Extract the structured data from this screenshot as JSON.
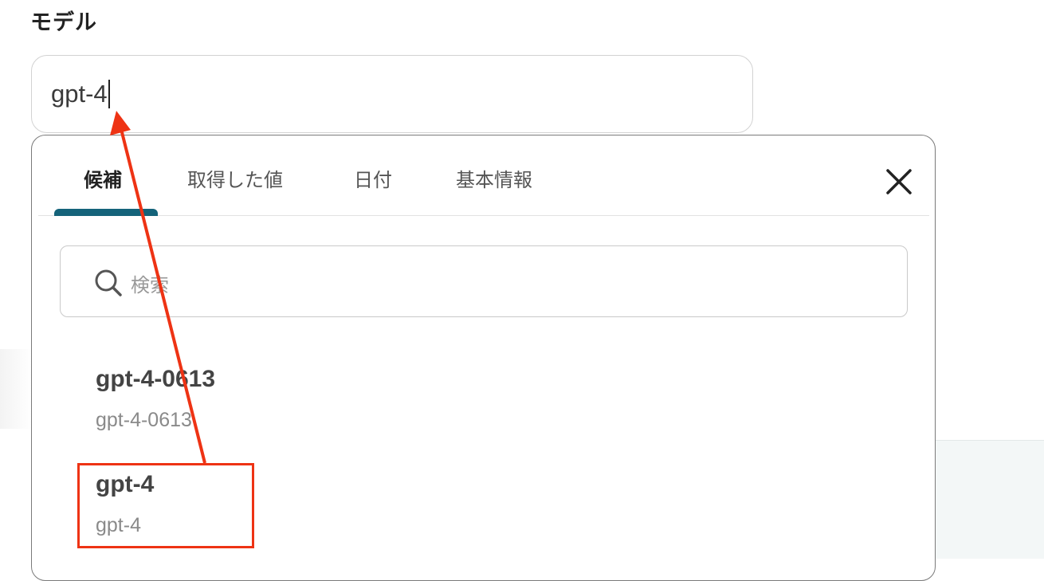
{
  "field": {
    "label": "モデル",
    "value": "gpt-4"
  },
  "tabs": [
    {
      "label": "候補",
      "active": true
    },
    {
      "label": "取得した値",
      "active": false
    },
    {
      "label": "日付",
      "active": false
    },
    {
      "label": "基本情報",
      "active": false
    }
  ],
  "search": {
    "placeholder": "検索"
  },
  "options": [
    {
      "title": "gpt-4-0613",
      "subtitle": "gpt-4-0613"
    },
    {
      "title": "gpt-4",
      "subtitle": "gpt-4"
    }
  ],
  "icons": {
    "close": "close-icon",
    "search": "search-icon"
  },
  "colors": {
    "active_tab_indicator": "#14637a",
    "annotation": "#ee3314",
    "dropdown_border": "#7a7a7a"
  }
}
